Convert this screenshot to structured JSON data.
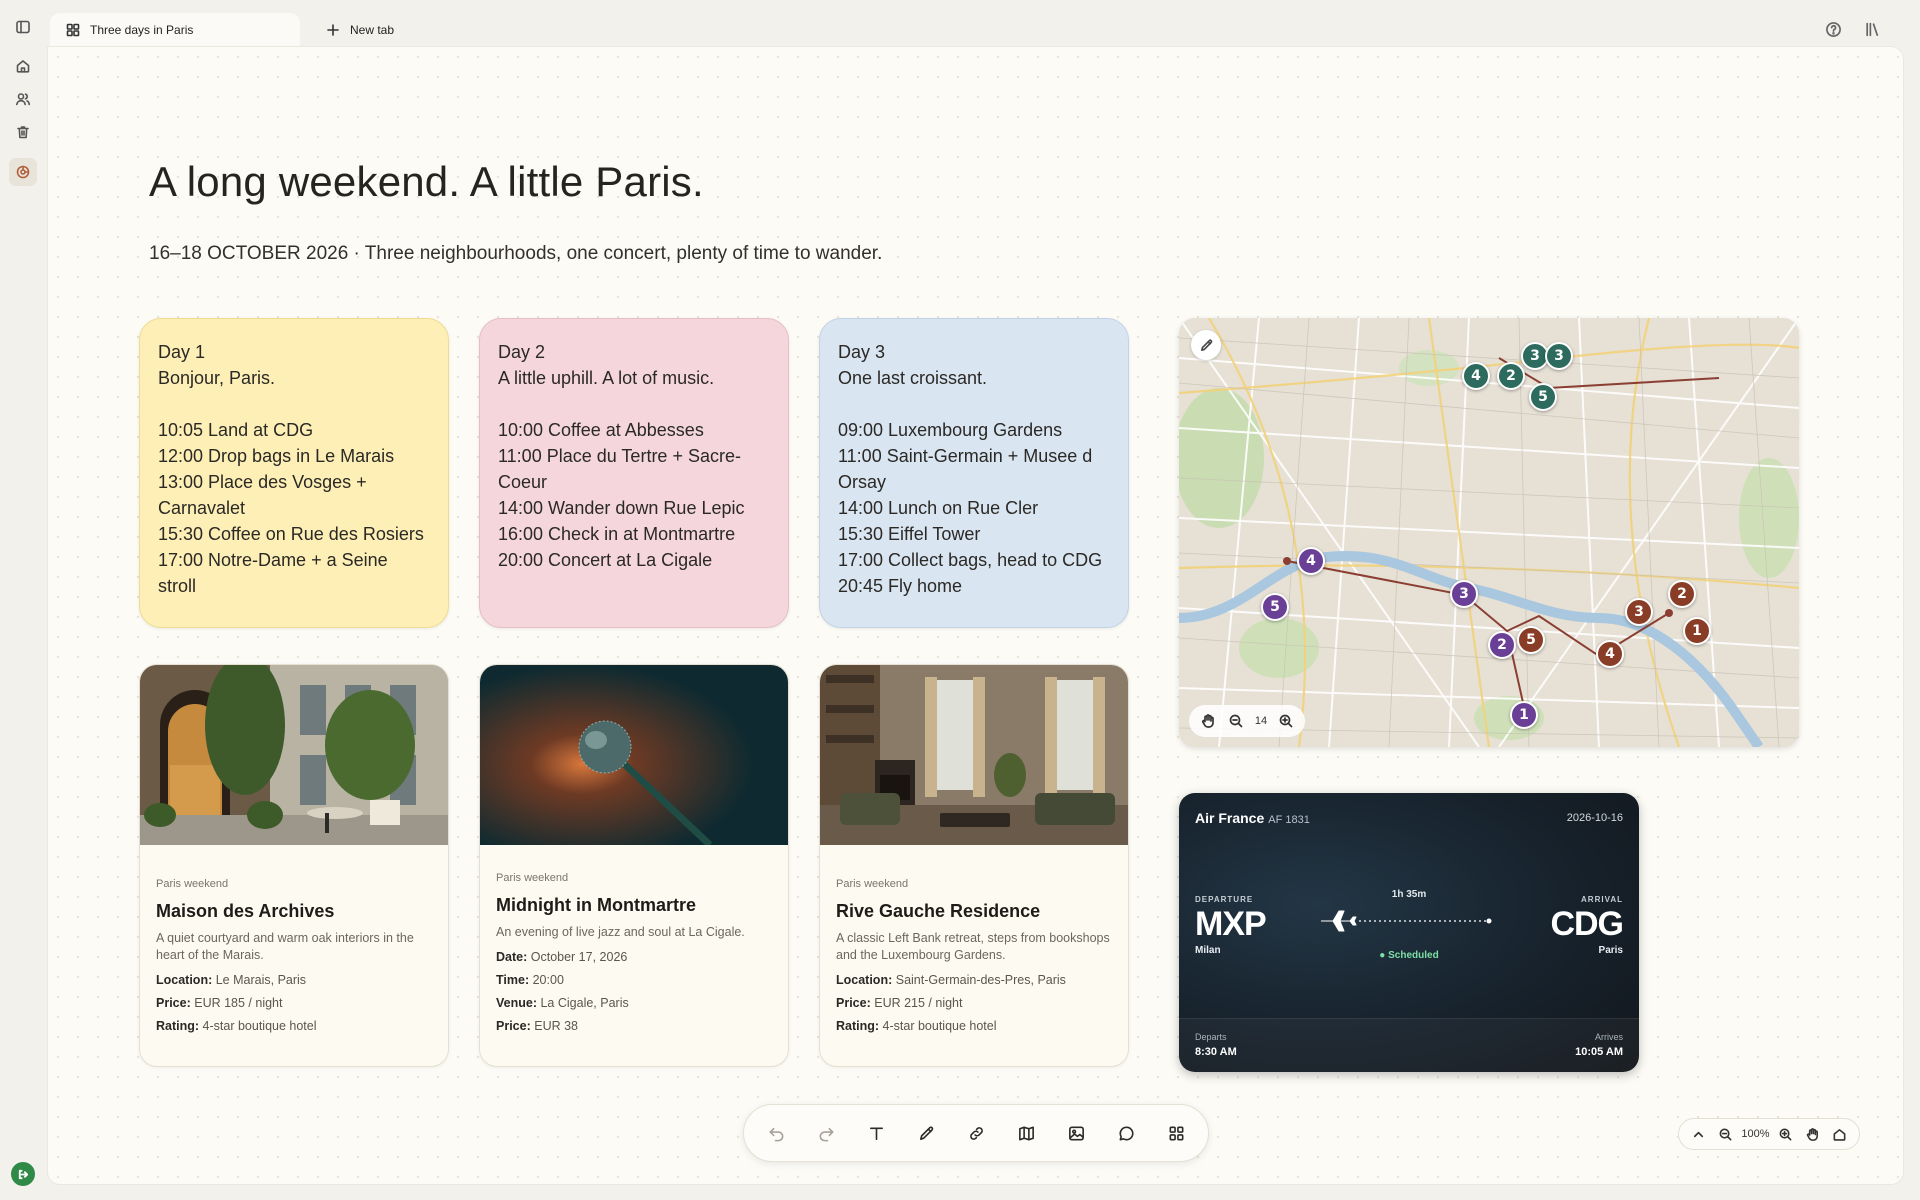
{
  "tabs": [
    {
      "label": "Three days in Paris",
      "icon": "grid-icon",
      "active": true
    },
    {
      "label": "New tab",
      "icon": "plus-icon",
      "active": false
    }
  ],
  "page": {
    "headline": "A long weekend. A little Paris.",
    "subline": "16–18 OCTOBER 2026 · Three neighbourhoods, one concert, plenty of time to wander."
  },
  "days": [
    {
      "heading": "Day 1",
      "tagline": "Bonjour, Paris.",
      "color": "#fdefb5",
      "lines": [
        "10:05 Land at CDG",
        "12:00 Drop bags in Le Marais",
        "13:00 Place des Vosges +",
        "Carnavalet",
        "15:30 Coffee on Rue des Rosiers",
        "17:00 Notre-Dame + a Seine",
        "stroll"
      ]
    },
    {
      "heading": "Day 2",
      "tagline": "A little uphill. A lot of music.",
      "color": "#f4d6dc",
      "lines": [
        "10:00 Coffee at Abbesses",
        "11:00 Place du Tertre + Sacre-",
        "Coeur",
        "14:00 Wander down Rue Lepic",
        "16:00 Check in at Montmartre",
        "20:00 Concert at La Cigale"
      ]
    },
    {
      "heading": "Day 3",
      "tagline": "One last croissant.",
      "color": "#d9e5f1",
      "lines": [
        "09:00 Luxembourg Gardens",
        "11:00 Saint-Germain + Musee d",
        "Orsay",
        "14:00 Lunch on Rue Cler",
        "15:30 Eiffel Tower",
        "17:00 Collect bags, head to CDG",
        "20:45 Fly home"
      ]
    }
  ],
  "cards": [
    {
      "tag": "Paris weekend",
      "title": "Maison des Archives",
      "desc": "A quiet courtyard and warm oak interiors in the heart of the Marais.",
      "rows": [
        {
          "k": "Location:",
          "v": "Le Marais, Paris"
        },
        {
          "k": "Price:",
          "v": "EUR 185 / night"
        },
        {
          "k": "Rating:",
          "v": "4-star boutique hotel"
        }
      ]
    },
    {
      "tag": "Paris weekend",
      "title": "Midnight in Montmartre",
      "desc": "An evening of live jazz and soul at La Cigale.",
      "rows": [
        {
          "k": "Date:",
          "v": "October 17, 2026"
        },
        {
          "k": "Time:",
          "v": "20:00"
        },
        {
          "k": "Venue:",
          "v": "La Cigale, Paris"
        },
        {
          "k": "Price:",
          "v": "EUR 38"
        }
      ]
    },
    {
      "tag": "Paris weekend",
      "title": "Rive Gauche Residence",
      "desc": "A classic Left Bank retreat, steps from bookshops and the Luxembourg Gardens.",
      "rows": [
        {
          "k": "Location:",
          "v": "Saint-Germain-des-Pres, Paris"
        },
        {
          "k": "Price:",
          "v": "EUR 215 / night"
        },
        {
          "k": "Rating:",
          "v": "4-star boutique hotel"
        }
      ]
    }
  ],
  "map": {
    "zoom_level": "14",
    "pins": {
      "green": [
        "2",
        "3",
        "4",
        "5"
      ],
      "purple": [
        "4",
        "5",
        "3",
        "2",
        "1"
      ],
      "brown": [
        "2",
        "3",
        "1",
        "4",
        "5"
      ]
    },
    "colors": {
      "green": "#2d6b5e",
      "purple": "#6a3f96",
      "brown": "#8a3d26"
    }
  },
  "flight": {
    "airline": "Air France",
    "flight_no": "AF 1831",
    "date": "2026-10-16",
    "departure_label": "DEPARTURE",
    "arrival_label": "ARRIVAL",
    "from_code": "MXP",
    "from_city": "Milan",
    "to_code": "CDG",
    "to_city": "Paris",
    "duration": "1h 35m",
    "status": "● Scheduled",
    "departs_label": "Departs",
    "departs_time": "8:30 AM",
    "arrives_label": "Arrives",
    "arrives_time": "10:05 AM"
  },
  "zoom": {
    "percent": "100%"
  }
}
